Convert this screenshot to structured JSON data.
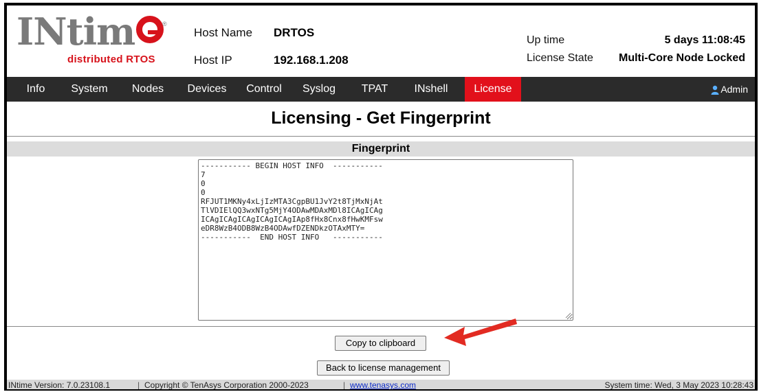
{
  "logo": {
    "word": "INtim",
    "registered": "®",
    "subtitle": "distributed RTOS"
  },
  "host": {
    "name_label": "Host Name",
    "name_value": "DRTOS",
    "ip_label": "Host IP",
    "ip_value": "192.168.1.208"
  },
  "status": {
    "uptime_label": "Up time",
    "uptime_value": "5 days 11:08:45",
    "license_label": "License State",
    "license_value": "Multi-Core Node Locked"
  },
  "nav": {
    "items": [
      {
        "label": "Info"
      },
      {
        "label": "System"
      },
      {
        "label": "Nodes"
      },
      {
        "label": "Devices"
      },
      {
        "label": "Control"
      },
      {
        "label": "Syslog"
      },
      {
        "label": "TPAT"
      },
      {
        "label": "INshell"
      },
      {
        "label": "License"
      }
    ],
    "active": "License",
    "user": "Admin"
  },
  "page": {
    "title": "Licensing - Get Fingerprint",
    "section": "Fingerprint"
  },
  "fingerprint_text": "----------- BEGIN HOST INFO  -----------\n7\n0\n0\nRFJUT1MKNy4xLjIzMTA3CgpBU1JvY2t8TjMxNjAt\nTlVDIElQQ3wxNTg5MjY4ODAwMDAxMDl8ICAgICAg\nICAgICAgICAgICAgICAgIAp8fHx8Cnx8fHwKMFsw\neDR8WzB4ODB8WzB4ODAwfDZENDkzOTAxMTY=\n-----------  END HOST INFO   -----------",
  "buttons": {
    "copy": "Copy to clipboard",
    "back": "Back to license management"
  },
  "footer": {
    "version": "INtime Version: 7.0.23108.1",
    "copyright": "Copyright © TenAsys Corporation 2000-2023",
    "link": "www.tenasys.com",
    "system_time": "System time: Wed, 3 May 2023 10:28:43"
  },
  "colors": {
    "accent_red": "#e2101b",
    "nav_bg": "#2b2b2b",
    "logo_gray": "#7a7a7a"
  }
}
